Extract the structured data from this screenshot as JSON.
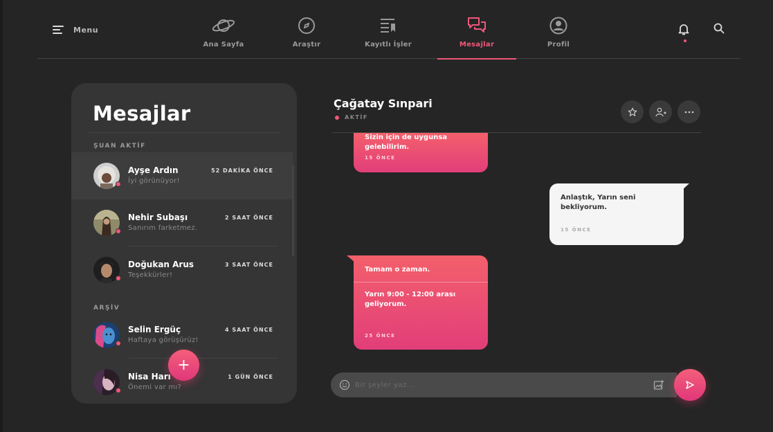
{
  "colors": {
    "accent": "#f0577a",
    "background": "#252525",
    "panel": "#353535"
  },
  "header": {
    "menu_label": "Menu",
    "nav": [
      {
        "label": "Ana Sayfa",
        "icon": "planet-icon"
      },
      {
        "label": "Araştır",
        "icon": "compass-icon"
      },
      {
        "label": "Kayıtlı İşler",
        "icon": "bookmarks-icon"
      },
      {
        "label": "Mesajlar",
        "icon": "chat-bubbles-icon",
        "active": true
      },
      {
        "label": "Profil",
        "icon": "user-circle-icon"
      }
    ]
  },
  "sidebar": {
    "title": "Mesajlar",
    "active_label": "ŞUAN AKTİF",
    "archive_label": "ARŞİV",
    "conversations": [
      {
        "name": "Ayşe Ardın",
        "snippet": "İyi görünüyor!",
        "time": "52 DAKİKA ÖNCE"
      },
      {
        "name": "Nehir Subaşı",
        "snippet": "Sanırım farketmez.",
        "time": "2 SAAT ÖNCE"
      },
      {
        "name": "Doğukan Arus",
        "snippet": "Teşekkürler!",
        "time": "3 SAAT ÖNCE"
      },
      {
        "name": "Selin Ergüç",
        "snippet": "Haftaya görüşürüz!",
        "time": "4 SAAT ÖNCE"
      },
      {
        "name": "Nisa Harı",
        "snippet": "Önemi var mı?",
        "time": "1 GÜN ÖNCE"
      }
    ],
    "fab_label": "+"
  },
  "chat": {
    "contact_name": "Çağatay Sınpari",
    "status": "AKTİF",
    "messages": [
      {
        "text": "Sizin için de uygunsa gelebilirim.",
        "time": "15 ÖNCE"
      },
      {
        "text": "Anlaştık, Yarın seni bekliyorum.",
        "time": "15 ÖNCE"
      },
      {
        "text": "Tamam o zaman.",
        "text2": "Yarın 9:00 - 12:00 arası geliyorum.",
        "time": "25 ÖNCE"
      }
    ],
    "composer_placeholder": "Bir şeyler yaz..."
  }
}
